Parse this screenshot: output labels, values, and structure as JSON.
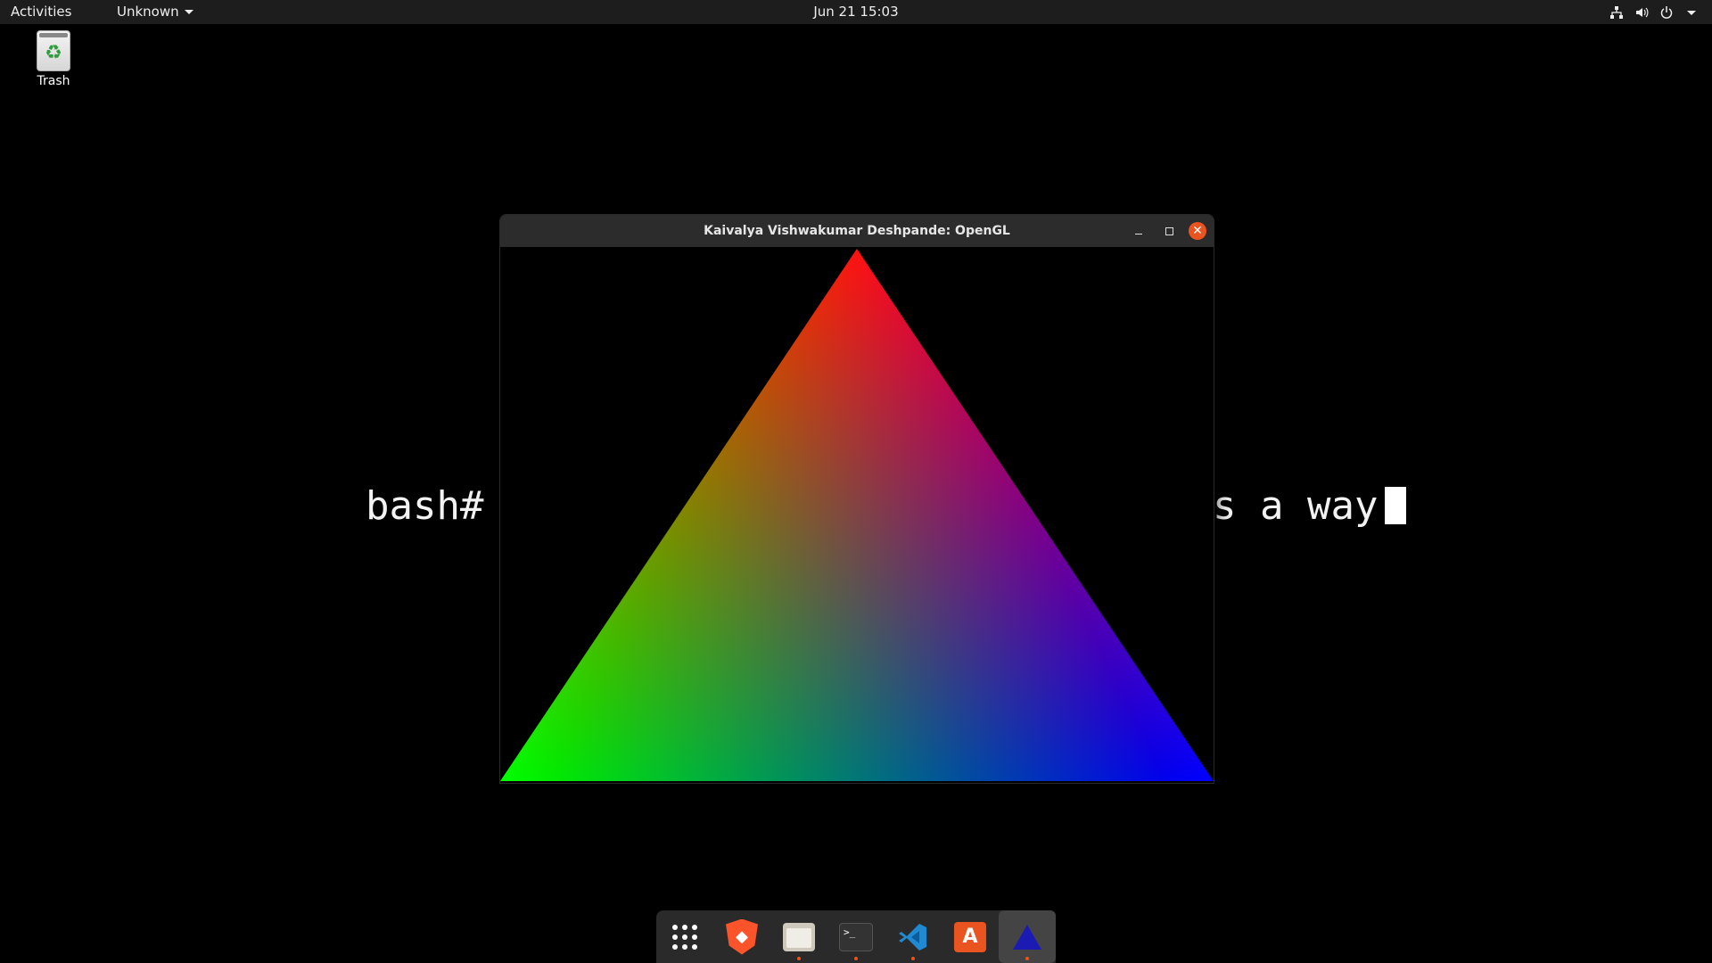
{
  "topbar": {
    "activities": "Activities",
    "app_menu": "Unknown",
    "clock": "Jun 21  15:03",
    "tray_icons": [
      "network-icon",
      "volume-icon",
      "power-icon",
      "system-menu-caret-icon"
    ]
  },
  "desktop": {
    "trash_label": "Trash"
  },
  "terminal": {
    "prompt": "bash#",
    "visible_tail": "s a way"
  },
  "window": {
    "title": "Kaivalya Vishwakumar Deshpande: OpenGL",
    "triangle_vertex_colors": [
      "#ff0000",
      "#00ff00",
      "#0000ff"
    ]
  },
  "dock": {
    "items": [
      {
        "name": "show-apps",
        "running": false
      },
      {
        "name": "brave-browser",
        "running": false
      },
      {
        "name": "files",
        "running": true
      },
      {
        "name": "terminal",
        "running": true
      },
      {
        "name": "visual-studio-code",
        "running": true
      },
      {
        "name": "ubuntu-software",
        "running": false
      },
      {
        "name": "opengl-app",
        "running": true
      }
    ]
  },
  "colors": {
    "accent": "#e95420",
    "topbar_bg": "#1d1d1d",
    "dock_bg": "#2a2a2a"
  }
}
